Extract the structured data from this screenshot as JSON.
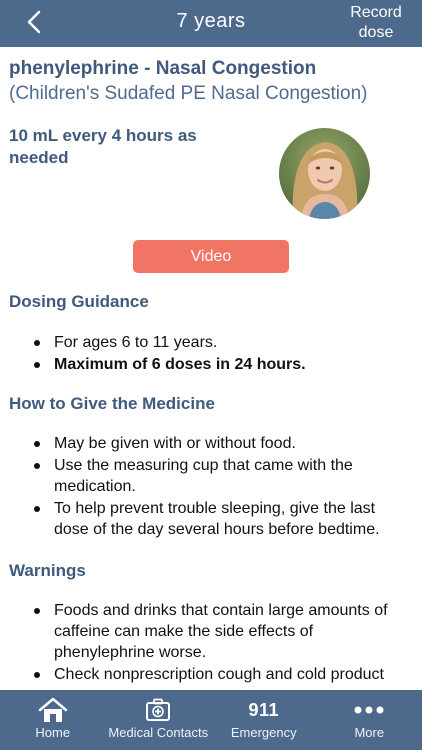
{
  "header": {
    "title": "7 years",
    "record_label_line1": "Record",
    "record_label_line2": "dose"
  },
  "medication": {
    "name": "phenylephrine - Nasal Congestion",
    "brand": "(Children's Sudafed PE Nasal Congestion)",
    "dose": "10 mL every 4 hours as needed"
  },
  "video_button": {
    "label": "Video"
  },
  "sections": {
    "dosing": {
      "title": "Dosing Guidance",
      "items": [
        "For ages 6 to 11 years.",
        "Maximum of 6 doses in 24 hours."
      ]
    },
    "how_to_give": {
      "title": "How to Give the Medicine",
      "items": [
        "May be given with or without food.",
        "Use the measuring cup that came with the medication.",
        "To help prevent trouble sleeping, give the last dose of the day several hours before bedtime."
      ]
    },
    "warnings": {
      "title": "Warnings",
      "items": [
        "Foods and drinks that contain large amounts of caffeine can make the side effects of phenylephrine worse.",
        "Check nonprescription cough and cold product"
      ]
    }
  },
  "tabbar": {
    "items": [
      {
        "label": "Home",
        "icon": "home-icon"
      },
      {
        "label": "Medical Contacts",
        "icon": "medical-kit-icon"
      },
      {
        "label": "Emergency",
        "icon": "911-text",
        "icon_text": "911"
      },
      {
        "label": "More",
        "icon": "more-dots-icon"
      }
    ]
  },
  "colors": {
    "bar_background": "#4d6a8c",
    "heading_text": "#3f5a7d",
    "video_button": "#f07565"
  }
}
